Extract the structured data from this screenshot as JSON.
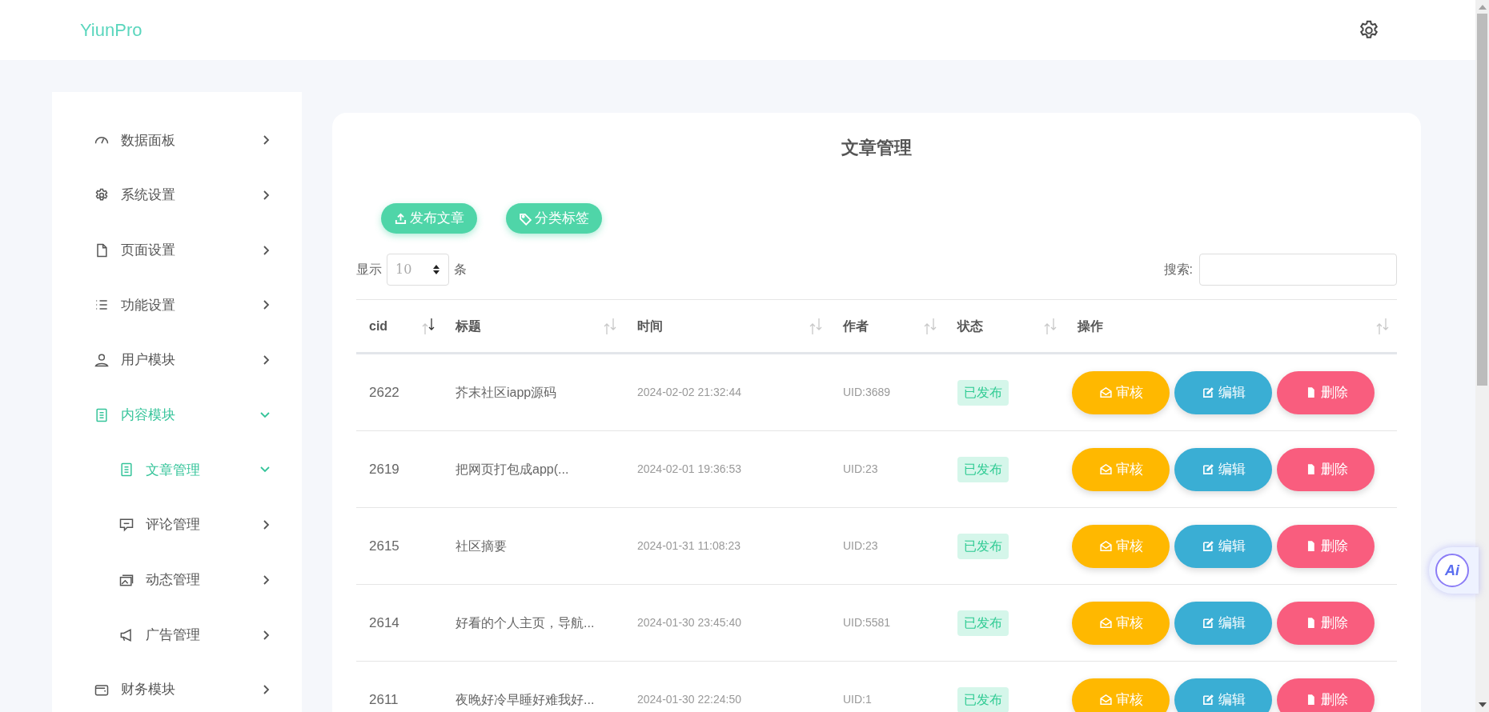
{
  "header": {
    "logo": "YiunPro"
  },
  "sidebar": {
    "items": [
      {
        "label": "数据面板",
        "selected": false,
        "expanded": false
      },
      {
        "label": "系统设置",
        "selected": false,
        "expanded": false
      },
      {
        "label": "页面设置",
        "selected": false,
        "expanded": false
      },
      {
        "label": "功能设置",
        "selected": false,
        "expanded": false
      },
      {
        "label": "用户模块",
        "selected": false,
        "expanded": false
      },
      {
        "label": "内容模块",
        "selected": true,
        "expanded": true,
        "children": [
          {
            "label": "文章管理",
            "selected": true,
            "expanded": true
          },
          {
            "label": "评论管理",
            "selected": false,
            "expanded": false
          },
          {
            "label": "动态管理",
            "selected": false,
            "expanded": false
          },
          {
            "label": "广告管理",
            "selected": false,
            "expanded": false
          }
        ]
      },
      {
        "label": "财务模块",
        "selected": false,
        "expanded": false
      }
    ]
  },
  "content": {
    "title": "文章管理",
    "toolbar_buttons": [
      "发布文章",
      "分类标签"
    ],
    "length_menu": {
      "prefix": "显示",
      "value": "10",
      "suffix": "条"
    },
    "search": {
      "label": "搜索:"
    },
    "table": {
      "columns": [
        {
          "label": "cid",
          "sorted_descending": true
        },
        {
          "label": "标题",
          "sorted_descending": false
        },
        {
          "label": "时间",
          "sorted_descending": false
        },
        {
          "label": "作者",
          "sorted_descending": false
        },
        {
          "label": "状态",
          "sorted_descending": false
        },
        {
          "label": "操作",
          "sorted_descending": false
        }
      ],
      "rows": [
        {
          "cid": "2622",
          "title": "芥末社区iapp源码",
          "time": "2024-02-02 21:32:44",
          "author": "UID:3689",
          "status": "已发布",
          "actions": [
            "审核",
            "编辑",
            "删除"
          ]
        },
        {
          "cid": "2619",
          "title": "把网页打包成app(...",
          "time": "2024-02-01 19:36:53",
          "author": "UID:23",
          "status": "已发布",
          "actions": [
            "审核",
            "编辑",
            "删除"
          ]
        },
        {
          "cid": "2615",
          "title": "社区摘要",
          "time": "2024-01-31 11:08:23",
          "author": "UID:23",
          "status": "已发布",
          "actions": [
            "审核",
            "编辑",
            "删除"
          ]
        },
        {
          "cid": "2614",
          "title": "好看的个人主页，导航...",
          "time": "2024-01-30 23:45:40",
          "author": "UID:5581",
          "status": "已发布",
          "actions": [
            "审核",
            "编辑",
            "删除"
          ]
        },
        {
          "cid": "2611",
          "title": "夜晚好冷早睡好难我好...",
          "time": "2024-01-30 22:24:50",
          "author": "UID:1",
          "status": "已发布",
          "actions": [
            "审核",
            "编辑",
            "删除"
          ]
        }
      ]
    }
  },
  "float_button": {
    "label": "Ai"
  }
}
